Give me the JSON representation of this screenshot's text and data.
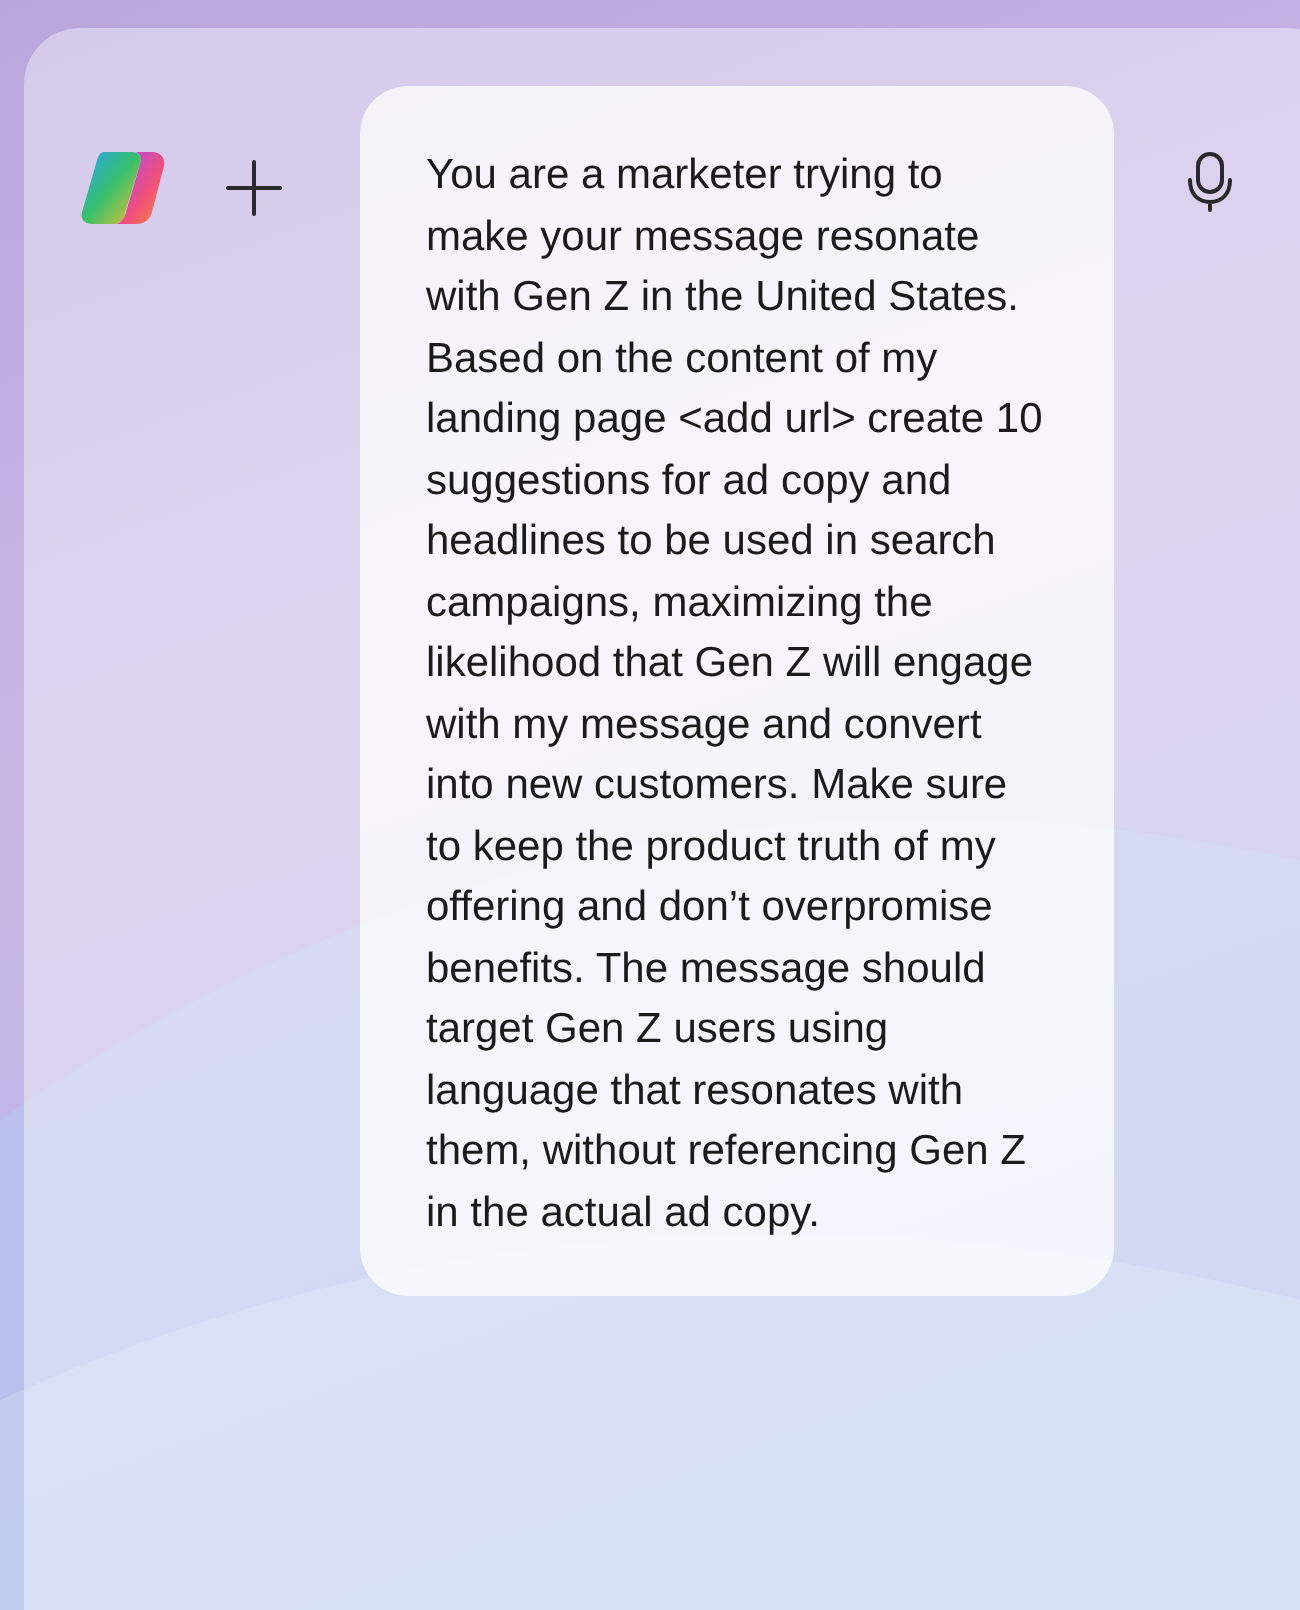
{
  "prompt": {
    "text": "You are a marketer trying to make your message resonate with Gen Z in the United States. Based on the content of my landing page <add url> create 10 suggestions for ad copy and headlines to be used in search campaigns, maximizing the likelihood that Gen Z will engage with my message and convert into new customers. Make sure to keep the product truth of my offering and don’t overpromise benefits. The message should target Gen Z users using language that resonates with them, without referencing Gen Z in the actual ad copy."
  }
}
